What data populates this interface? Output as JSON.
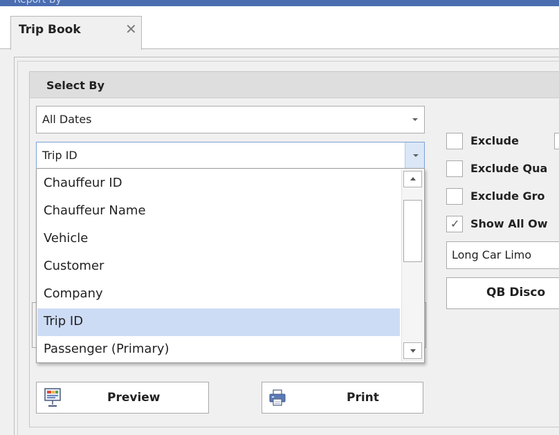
{
  "window": {
    "title": "Report By"
  },
  "tabs": [
    {
      "label": "Trip Book",
      "close": "✕"
    }
  ],
  "select_by": {
    "title": "Select By",
    "date_filter": {
      "value": "All Dates"
    },
    "sort_field": {
      "value": "Trip ID",
      "options": [
        "Chauffeur ID",
        "Chauffeur Name",
        "Vehicle",
        "Customer",
        "Company",
        "Trip ID",
        "Passenger (Primary)"
      ],
      "selected": "Trip ID"
    }
  },
  "options": {
    "exclude": {
      "label": "Exclude",
      "checked": false
    },
    "exclude_qua": {
      "label": "Exclude Qua",
      "checked": false
    },
    "exclude_gro": {
      "label": "Exclude Gro",
      "checked": false
    },
    "show_all_ow": {
      "label": "Show All Ow",
      "checked": true,
      "check_glyph": "✓"
    },
    "company_combo": {
      "value": "Long Car Limo"
    },
    "qb_button": {
      "label": "QB Disco"
    }
  },
  "actions": {
    "preview": {
      "label": "Preview",
      "icon": "presentation-icon"
    },
    "print": {
      "label": "Print",
      "icon": "printer-icon"
    }
  }
}
